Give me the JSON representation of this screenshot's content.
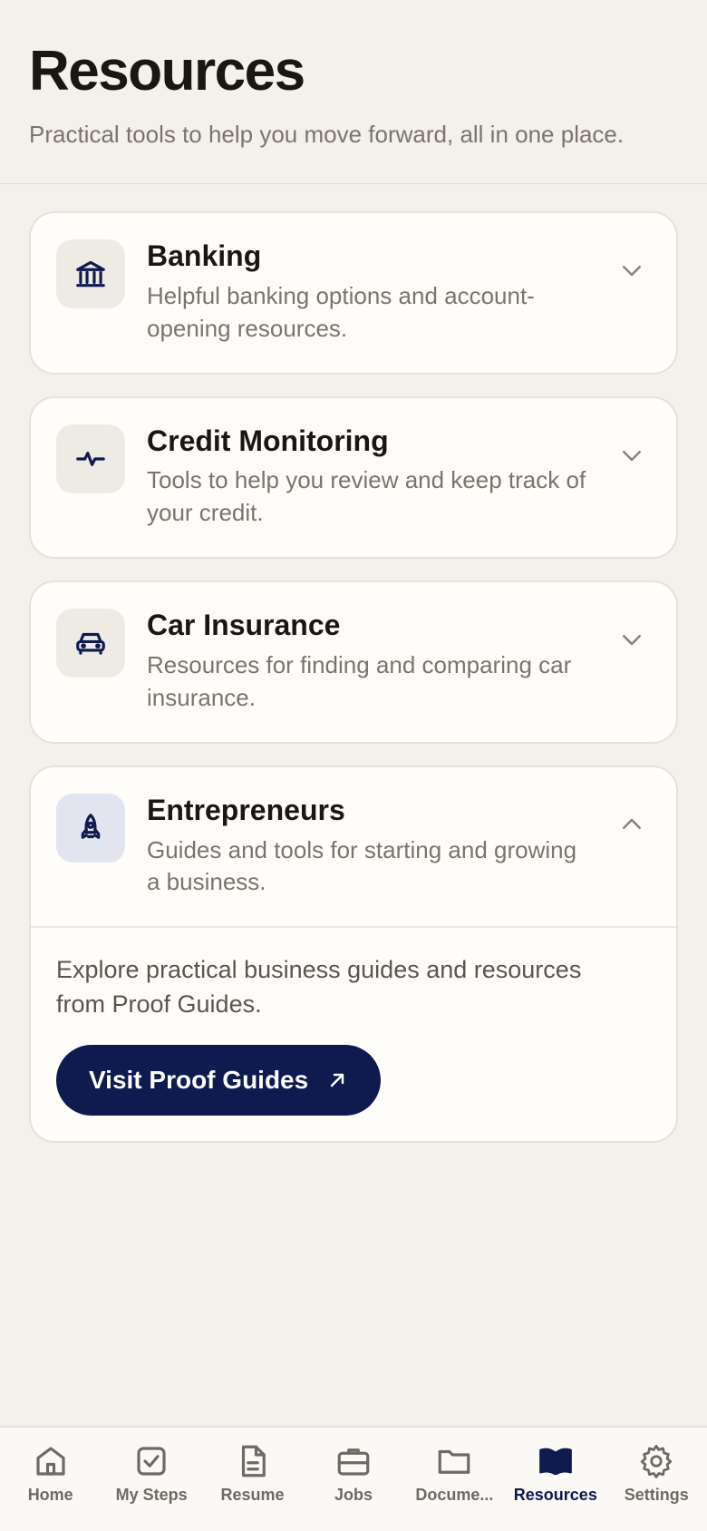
{
  "header": {
    "title": "Resources",
    "subtitle": "Practical tools to help you move forward, all in one place."
  },
  "cards": [
    {
      "title": "Banking",
      "description": "Helpful banking options and account-opening resources.",
      "icon": "bank-icon",
      "expanded": false
    },
    {
      "title": "Credit Monitoring",
      "description": "Tools to help you review and keep track of your credit.",
      "icon": "pulse-icon",
      "expanded": false
    },
    {
      "title": "Car Insurance",
      "description": "Resources for finding and comparing car insurance.",
      "icon": "car-icon",
      "expanded": false
    },
    {
      "title": "Entrepreneurs",
      "description": "Guides and tools for starting and growing a business.",
      "icon": "rocket-icon",
      "expanded": true,
      "body": "Explore practical business guides and resources from Proof Guides.",
      "cta_label": "Visit Proof Guides"
    }
  ],
  "tabs": [
    {
      "label": "Home",
      "icon": "home-icon"
    },
    {
      "label": "My Steps",
      "icon": "checkbox-icon"
    },
    {
      "label": "Resume",
      "icon": "document-icon"
    },
    {
      "label": "Jobs",
      "icon": "briefcase-icon"
    },
    {
      "label": "Docume...",
      "icon": "folder-icon"
    },
    {
      "label": "Resources",
      "icon": "book-icon",
      "active": true
    },
    {
      "label": "Settings",
      "icon": "gear-icon"
    }
  ],
  "colors": {
    "background": "#f4f0eb",
    "accent": "#0f1a4f",
    "muted_text": "#7a746c"
  }
}
